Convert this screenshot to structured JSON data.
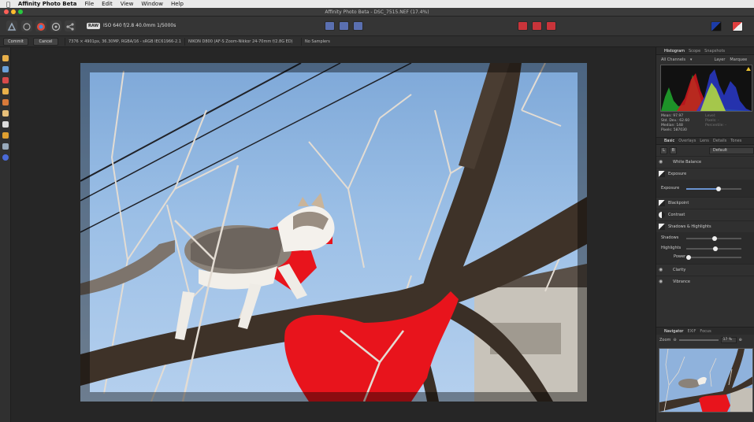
{
  "menubar": {
    "app_name": "Affinity Photo Beta",
    "items": [
      "File",
      "Edit",
      "View",
      "Window",
      "Help"
    ]
  },
  "window": {
    "title": "Affinity Photo Beta - DSC_7515.NEF (17.4%)"
  },
  "toolbar": {
    "raw_badge": "RAW",
    "exif": "ISO 640  f/2.8  40.0mm  1/5000s"
  },
  "context": {
    "commit_label": "Commit",
    "cancel_label": "Cancel",
    "info": [
      "7376 × 4901px, 36.30MP, RGBA/16 - sRGB IEC61966-2.1",
      "NIKON D800 (AF-S Zoom-Nikkor 24-70mm f/2.8G ED)",
      "No Samplers"
    ]
  },
  "panel": {
    "top_tabs": [
      "Histogram",
      "Scope",
      "Snapshots"
    ],
    "channels": "All Channels",
    "layer_label": "Layer",
    "marquee_label": "Marquee",
    "stats_left": [
      "Mean: 97.97",
      "Std. Dev.: 62.60",
      "Median: 148",
      "Pixels: 587030"
    ],
    "stats_right": [
      "Level:",
      "Pixels: -",
      "Percentile: -"
    ],
    "section_tabs": [
      "Basic",
      "Overlays",
      "Lens",
      "Details",
      "Tones"
    ],
    "preset_value": "Default",
    "btn_l": "L",
    "btn_b": "B",
    "adjustments": {
      "white_balance": "White Balance",
      "exposure": "Exposure",
      "exposure_slider": "Exposure",
      "blackpoint": "Blackpoint",
      "contrast": "Contrast",
      "shadows_highlights": "Shadows & Highlights",
      "shadows": "Shadows",
      "highlights": "Highlights",
      "power": "Power",
      "clarity": "Clarity",
      "vibrance": "Vibrance"
    },
    "slider_values": {
      "exposure": 0.55,
      "shadows": 0.5,
      "highlights": 0.52,
      "power": 0.05
    },
    "nav_tabs": [
      "Navigator",
      "EXIF",
      "Focus"
    ],
    "zoom_label": "Zoom",
    "zoom_value": "17 %"
  }
}
